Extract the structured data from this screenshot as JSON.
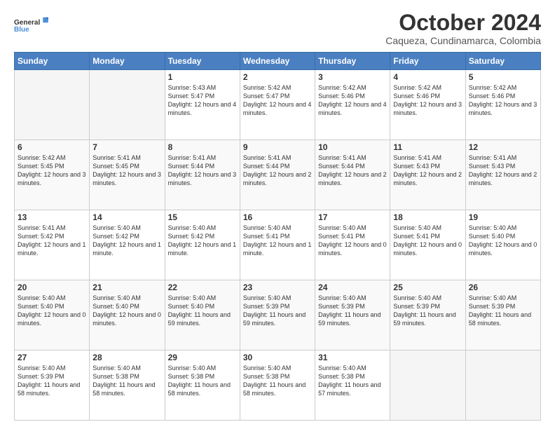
{
  "logo": {
    "line1": "General",
    "line2": "Blue"
  },
  "header": {
    "month": "October 2024",
    "location": "Caqueza, Cundinamarca, Colombia"
  },
  "weekdays": [
    "Sunday",
    "Monday",
    "Tuesday",
    "Wednesday",
    "Thursday",
    "Friday",
    "Saturday"
  ],
  "weeks": [
    [
      {
        "day": "",
        "empty": true
      },
      {
        "day": "",
        "empty": true
      },
      {
        "day": "1",
        "sunrise": "5:43 AM",
        "sunset": "5:47 PM",
        "daylight": "12 hours and 4 minutes."
      },
      {
        "day": "2",
        "sunrise": "5:42 AM",
        "sunset": "5:47 PM",
        "daylight": "12 hours and 4 minutes."
      },
      {
        "day": "3",
        "sunrise": "5:42 AM",
        "sunset": "5:46 PM",
        "daylight": "12 hours and 4 minutes."
      },
      {
        "day": "4",
        "sunrise": "5:42 AM",
        "sunset": "5:46 PM",
        "daylight": "12 hours and 3 minutes."
      },
      {
        "day": "5",
        "sunrise": "5:42 AM",
        "sunset": "5:46 PM",
        "daylight": "12 hours and 3 minutes."
      }
    ],
    [
      {
        "day": "6",
        "sunrise": "5:42 AM",
        "sunset": "5:45 PM",
        "daylight": "12 hours and 3 minutes."
      },
      {
        "day": "7",
        "sunrise": "5:41 AM",
        "sunset": "5:45 PM",
        "daylight": "12 hours and 3 minutes."
      },
      {
        "day": "8",
        "sunrise": "5:41 AM",
        "sunset": "5:44 PM",
        "daylight": "12 hours and 3 minutes."
      },
      {
        "day": "9",
        "sunrise": "5:41 AM",
        "sunset": "5:44 PM",
        "daylight": "12 hours and 2 minutes."
      },
      {
        "day": "10",
        "sunrise": "5:41 AM",
        "sunset": "5:44 PM",
        "daylight": "12 hours and 2 minutes."
      },
      {
        "day": "11",
        "sunrise": "5:41 AM",
        "sunset": "5:43 PM",
        "daylight": "12 hours and 2 minutes."
      },
      {
        "day": "12",
        "sunrise": "5:41 AM",
        "sunset": "5:43 PM",
        "daylight": "12 hours and 2 minutes."
      }
    ],
    [
      {
        "day": "13",
        "sunrise": "5:41 AM",
        "sunset": "5:42 PM",
        "daylight": "12 hours and 1 minute."
      },
      {
        "day": "14",
        "sunrise": "5:40 AM",
        "sunset": "5:42 PM",
        "daylight": "12 hours and 1 minute."
      },
      {
        "day": "15",
        "sunrise": "5:40 AM",
        "sunset": "5:42 PM",
        "daylight": "12 hours and 1 minute."
      },
      {
        "day": "16",
        "sunrise": "5:40 AM",
        "sunset": "5:41 PM",
        "daylight": "12 hours and 1 minute."
      },
      {
        "day": "17",
        "sunrise": "5:40 AM",
        "sunset": "5:41 PM",
        "daylight": "12 hours and 0 minutes."
      },
      {
        "day": "18",
        "sunrise": "5:40 AM",
        "sunset": "5:41 PM",
        "daylight": "12 hours and 0 minutes."
      },
      {
        "day": "19",
        "sunrise": "5:40 AM",
        "sunset": "5:40 PM",
        "daylight": "12 hours and 0 minutes."
      }
    ],
    [
      {
        "day": "20",
        "sunrise": "5:40 AM",
        "sunset": "5:40 PM",
        "daylight": "12 hours and 0 minutes."
      },
      {
        "day": "21",
        "sunrise": "5:40 AM",
        "sunset": "5:40 PM",
        "daylight": "12 hours and 0 minutes."
      },
      {
        "day": "22",
        "sunrise": "5:40 AM",
        "sunset": "5:40 PM",
        "daylight": "11 hours and 59 minutes."
      },
      {
        "day": "23",
        "sunrise": "5:40 AM",
        "sunset": "5:39 PM",
        "daylight": "11 hours and 59 minutes."
      },
      {
        "day": "24",
        "sunrise": "5:40 AM",
        "sunset": "5:39 PM",
        "daylight": "11 hours and 59 minutes."
      },
      {
        "day": "25",
        "sunrise": "5:40 AM",
        "sunset": "5:39 PM",
        "daylight": "11 hours and 59 minutes."
      },
      {
        "day": "26",
        "sunrise": "5:40 AM",
        "sunset": "5:39 PM",
        "daylight": "11 hours and 58 minutes."
      }
    ],
    [
      {
        "day": "27",
        "sunrise": "5:40 AM",
        "sunset": "5:39 PM",
        "daylight": "11 hours and 58 minutes."
      },
      {
        "day": "28",
        "sunrise": "5:40 AM",
        "sunset": "5:38 PM",
        "daylight": "11 hours and 58 minutes."
      },
      {
        "day": "29",
        "sunrise": "5:40 AM",
        "sunset": "5:38 PM",
        "daylight": "11 hours and 58 minutes."
      },
      {
        "day": "30",
        "sunrise": "5:40 AM",
        "sunset": "5:38 PM",
        "daylight": "11 hours and 58 minutes."
      },
      {
        "day": "31",
        "sunrise": "5:40 AM",
        "sunset": "5:38 PM",
        "daylight": "11 hours and 57 minutes."
      },
      {
        "day": "",
        "empty": true
      },
      {
        "day": "",
        "empty": true
      }
    ]
  ]
}
